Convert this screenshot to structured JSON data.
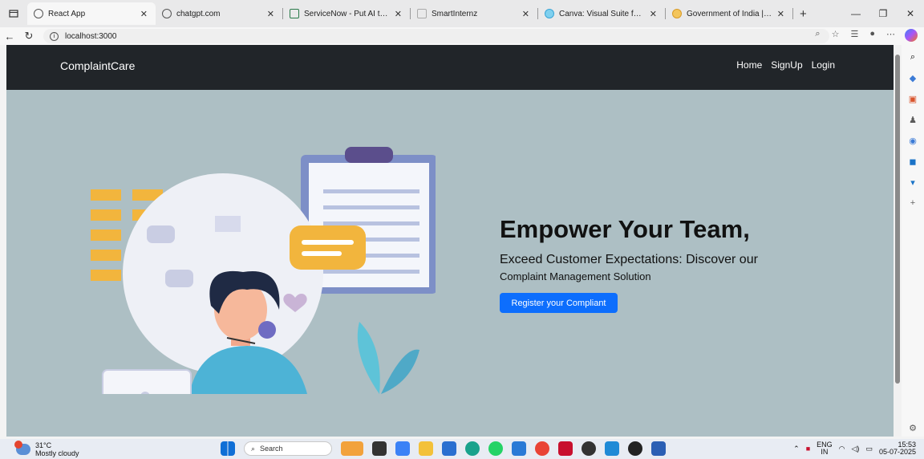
{
  "browser": {
    "tabs": [
      {
        "label": "React App",
        "active": true
      },
      {
        "label": "chatgpt.com",
        "active": false
      },
      {
        "label": "ServiceNow - Put AI to Work",
        "active": false
      },
      {
        "label": "SmartInternz",
        "active": false
      },
      {
        "label": "Canva: Visual Suite for Every",
        "active": false
      },
      {
        "label": "Government of India | All Ind",
        "active": false
      }
    ],
    "url": "localhost:3000"
  },
  "navbar": {
    "brand": "ComplaintCare",
    "links": [
      "Home",
      "SignUp",
      "Login"
    ]
  },
  "hero": {
    "title": "Empower Your Team,",
    "subtitle": "Exceed Customer Expectations: Discover our",
    "subtitle2": "Complaint Management Solution",
    "cta_label": "Register your Compliant"
  },
  "taskbar": {
    "weather_temp": "31°C",
    "weather_desc": "Mostly cloudy",
    "search_placeholder": "Search",
    "lang": "ENG",
    "region": "IN",
    "time": "15:53",
    "date": "05-07-2025"
  },
  "colors": {
    "navbar_bg": "#212529",
    "hero_bg": "#adbfc4",
    "cta_bg": "#0d6efd"
  }
}
